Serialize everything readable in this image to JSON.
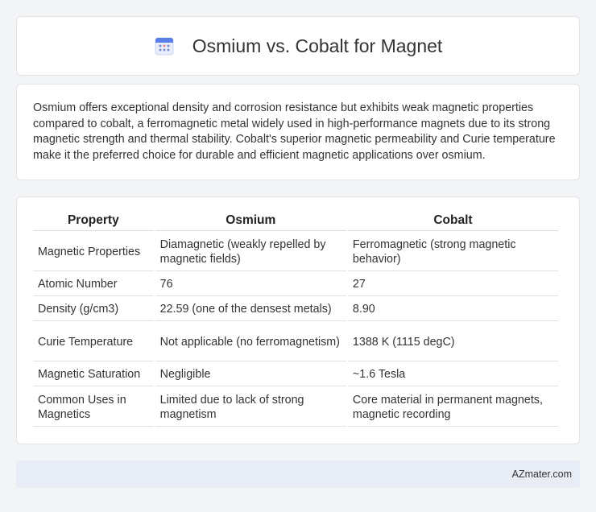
{
  "header": {
    "title": "Osmium vs. Cobalt for Magnet",
    "icon": "calendar-icon",
    "accent": "#5b7fe6"
  },
  "summary": {
    "text": "Osmium offers exceptional density and corrosion resistance but exhibits weak magnetic properties compared to cobalt, a ferromagnetic metal widely used in high-performance magnets due to its strong magnetic strength and thermal stability. Cobalt's superior magnetic permeability and Curie temperature make it the preferred choice for durable and efficient magnetic applications over osmium."
  },
  "table": {
    "headers": [
      "Property",
      "Osmium",
      "Cobalt"
    ],
    "rows": [
      [
        "Magnetic Properties",
        "Diamagnetic (weakly repelled by magnetic fields)",
        "Ferromagnetic (strong magnetic behavior)"
      ],
      [
        "Atomic Number",
        "76",
        "27"
      ],
      [
        "Density (g/cm3)",
        "22.59 (one of the densest metals)",
        "8.90"
      ],
      [
        "Curie Temperature",
        "Not applicable (no ferromagnetism)",
        "1388 K (1115 degC)"
      ],
      [
        "Magnetic Saturation",
        "Negligible",
        "~1.6 Tesla"
      ],
      [
        "Common Uses in Magnetics",
        "Limited due to lack of strong magnetism",
        "Core material in permanent magnets, magnetic recording"
      ]
    ]
  },
  "footer": {
    "brand": "AZmater.com"
  }
}
